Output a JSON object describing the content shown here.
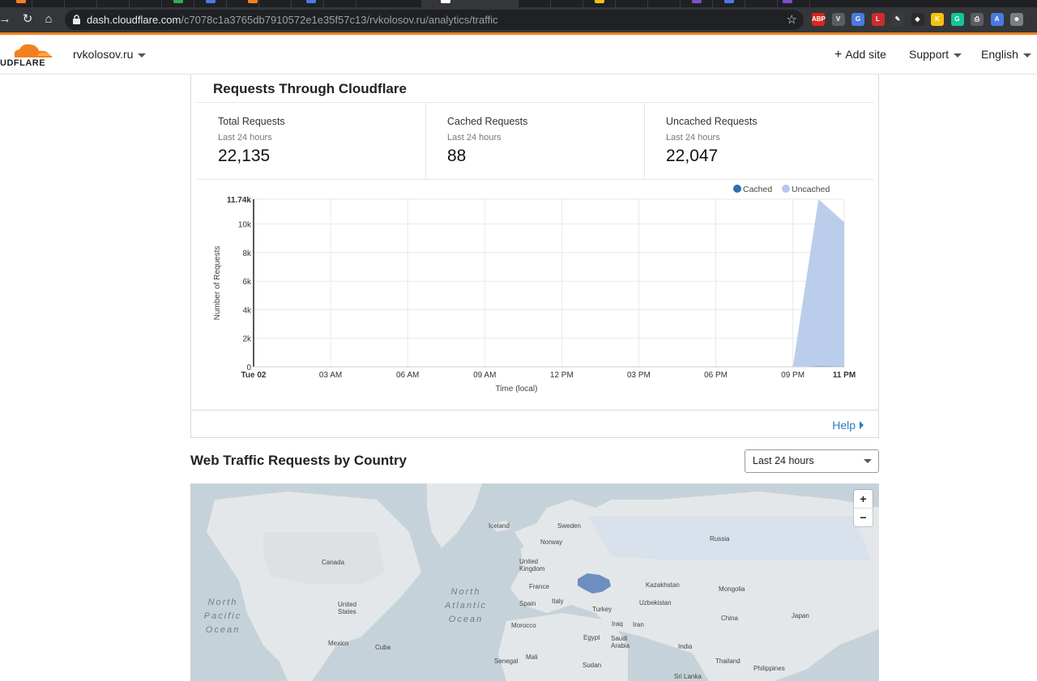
{
  "browser": {
    "url_host": "dash.cloudflare.com",
    "url_path": "/c7078c1a3765db7910572e1e35f57c13/rvkolosov.ru/analytics/traffic",
    "extensions": [
      {
        "name": "adblock-plus-icon",
        "label": "ABP",
        "color": "#d7261e"
      },
      {
        "name": "vuejs-devtools-icon",
        "label": "V",
        "color": "#5a5d61"
      },
      {
        "name": "translate-icon",
        "label": "G",
        "color": "#4a7ae0"
      },
      {
        "name": "lastpass-icon",
        "label": "L",
        "color": "#cc2c2c"
      },
      {
        "name": "pen-icon",
        "label": "✎",
        "color": "#3a3b3e"
      },
      {
        "name": "cube-icon",
        "label": "◆",
        "color": "#2b2b2b"
      },
      {
        "name": "keep-icon",
        "label": "K",
        "color": "#f4c20d"
      },
      {
        "name": "grammarly-icon",
        "label": "G",
        "color": "#15c39a"
      },
      {
        "name": "printer-icon",
        "label": "⎙",
        "color": "#5a5d61"
      },
      {
        "name": "arrow-icon",
        "label": "A",
        "color": "#4a7ae0"
      },
      {
        "name": "account-icon",
        "label": "☻",
        "color": "#7c7f84"
      }
    ]
  },
  "header": {
    "logo_text": "UDFLARE",
    "site": "rvkolosov.ru",
    "add_site": "Add site",
    "support": "Support",
    "language": "English"
  },
  "requests_panel": {
    "title": "Requests Through Cloudflare",
    "stats": [
      {
        "label": "Total Requests",
        "period": "Last 24 hours",
        "value": "22,135"
      },
      {
        "label": "Cached Requests",
        "period": "Last 24 hours",
        "value": "88"
      },
      {
        "label": "Uncached Requests",
        "period": "Last 24 hours",
        "value": "22,047"
      }
    ],
    "help": "Help"
  },
  "chart_data": {
    "type": "area",
    "title": "",
    "xlabel": "Time (local)",
    "ylabel": "Number of Requests",
    "x_ticks": [
      "Tue 02",
      "03 AM",
      "06 AM",
      "09 AM",
      "12 PM",
      "03 PM",
      "06 PM",
      "09 PM",
      "11 PM"
    ],
    "x_hours": [
      0,
      3,
      6,
      9,
      12,
      15,
      18,
      21,
      23
    ],
    "y_ticks": [
      "0",
      "2k",
      "4k",
      "6k",
      "8k",
      "10k",
      "11.74k"
    ],
    "y_tick_values": [
      0,
      2000,
      4000,
      6000,
      8000,
      10000,
      11740
    ],
    "ylim": [
      0,
      11740
    ],
    "xlim": [
      0,
      23
    ],
    "grid": true,
    "legend_position": "top-right",
    "series": [
      {
        "name": "Cached",
        "color": "#2c6fad",
        "x": [
          0,
          21,
          22,
          23
        ],
        "values": [
          0,
          0,
          50,
          38
        ]
      },
      {
        "name": "Uncached",
        "color": "#b3c9ea",
        "x": [
          0,
          21,
          22,
          23
        ],
        "values": [
          0,
          0,
          11740,
          10130
        ]
      }
    ]
  },
  "map_section": {
    "title": "Web Traffic Requests by Country",
    "range": "Last 24 hours",
    "zoom_in": "+",
    "zoom_out": "−",
    "countries": [
      "Iceland",
      "Sweden",
      "Norway",
      "Russia",
      "Canada",
      "United Kingdom",
      "France",
      "Spain",
      "Italy",
      "Turkey",
      "Kazakhstan",
      "Mongolia",
      "Uzbekistan",
      "United States",
      "Morocco",
      "Iraq",
      "Iran",
      "China",
      "Japan",
      "Egypt",
      "Saudi Arabia",
      "India",
      "Mexico",
      "Cuba",
      "Senegal",
      "Mali",
      "Sudan",
      "Thailand",
      "Philippines",
      "Sri Lanka"
    ],
    "oceans": {
      "north_pacific": "North Pacific Ocean",
      "north_atlantic": "North Atlantic Ocean"
    },
    "highlight_color": "#6d8fbf"
  }
}
